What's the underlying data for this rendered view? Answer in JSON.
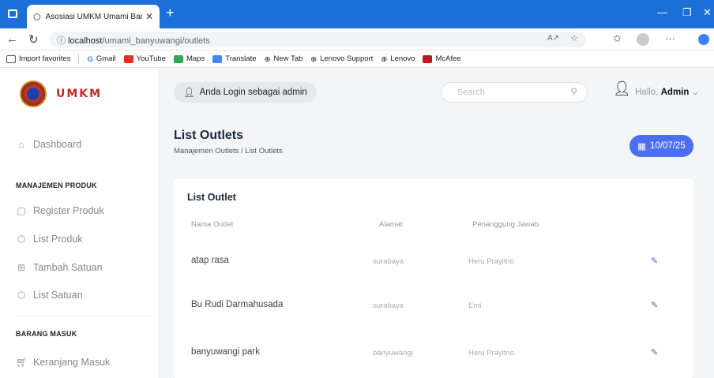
{
  "browser": {
    "tab_title": "Asosiasi UMKM Umami Banyuwa",
    "tab_close": "✕",
    "new_tab": "+",
    "url_prefix": "localhost",
    "url_path": "/umami_banyuwangi/outlets",
    "favorites": [
      {
        "label": "Import favorites",
        "color": "#ffffff"
      },
      {
        "label": "Gmail",
        "color": "#ffffff"
      },
      {
        "label": "YouTube",
        "color": "#e52d27"
      },
      {
        "label": "Maps",
        "color": "#34a853"
      },
      {
        "label": "Translate",
        "color": "#4285f4"
      },
      {
        "label": "New Tab",
        "color": "#ffffff"
      },
      {
        "label": "Lenovo Support",
        "color": "#ffffff"
      },
      {
        "label": "Lenovo",
        "color": "#ffffff"
      },
      {
        "label": "McAfee",
        "color": "#c01818"
      }
    ]
  },
  "sidebar": {
    "logo_text": "UMKM",
    "dashboard": "Dashboard",
    "section_produk": "MANAJEMEN PRODUK",
    "register_produk": "Register Produk",
    "list_produk": "List Produk",
    "tambah_satuan": "Tambah Satuan",
    "list_satuan": "List Satuan",
    "section_barang": "BARANG MASUK",
    "keranjang_masuk": "Keranjang Masuk"
  },
  "header": {
    "login_status": "Anda Login sebagai admin",
    "search_placeholder": "Search",
    "greeting": "Hallo,",
    "user_name": "Admin"
  },
  "page": {
    "title": "List Outlets",
    "breadcrumb": "Manajemen Outlets / List Outlets",
    "date": "10/07/25"
  },
  "card": {
    "title": "List Outlet",
    "columns": [
      "Nama Outlet",
      "Alamat",
      "Penanggung Jawab"
    ],
    "rows": [
      {
        "nama": "atap rasa",
        "alamat": "surabaya",
        "pj": "Heru Prayitno"
      },
      {
        "nama": "Bu Rudi Darmahusada",
        "alamat": "surabaya",
        "pj": "Emi"
      },
      {
        "nama": "banyuwangi park",
        "alamat": "banyuwangi",
        "pj": "Heru Prayitno"
      }
    ]
  },
  "colors": {
    "accent": "#4c6ff0",
    "browser_bar": "#1c6fd6",
    "brand_red": "#c62828"
  }
}
